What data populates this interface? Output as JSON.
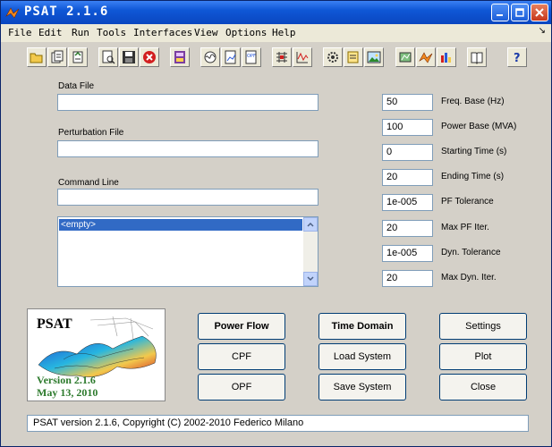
{
  "window": {
    "title": "PSAT 2.1.6"
  },
  "menu": [
    "File",
    "Edit",
    "Run",
    "Tools",
    "Interfaces",
    "View",
    "Options",
    "Help"
  ],
  "toolbar": {
    "icons": [
      "open-icon",
      "open-data-icon",
      "open-perturbation-icon",
      "view-data-icon",
      "save-icon",
      "close-data-icon",
      "library-icon",
      "simulink-icon",
      "report-icon",
      "opf-report-icon",
      "matrix-icon",
      "plot-icon",
      "settings-gear-icon",
      "edit-note-icon",
      "image-icon",
      "setup-icon",
      "matlab-icon",
      "bars-icon",
      "book-icon",
      "help-icon"
    ]
  },
  "left": {
    "data_file": {
      "label": "Data File",
      "value": ""
    },
    "perturbation_file": {
      "label": "Perturbation File",
      "value": ""
    },
    "command_line": {
      "label": "Command Line",
      "value": ""
    },
    "listbox": {
      "items": [
        "<empty>"
      ]
    }
  },
  "right": {
    "params": [
      {
        "value": "50",
        "label": "Freq. Base (Hz)"
      },
      {
        "value": "100",
        "label": "Power Base (MVA)"
      },
      {
        "value": "0",
        "label": "Starting Time (s)"
      },
      {
        "value": "20",
        "label": "Ending Time (s)"
      },
      {
        "value": "1e-005",
        "label": "PF Tolerance"
      },
      {
        "value": "20",
        "label": "Max PF Iter."
      },
      {
        "value": "1e-005",
        "label": "Dyn. Tolerance"
      },
      {
        "value": "20",
        "label": "Max Dyn. Iter."
      }
    ]
  },
  "logo": {
    "title": "PSAT",
    "version": "Version 2.1.6",
    "date": "May 13, 2010"
  },
  "buttons": {
    "power_flow": "Power Flow",
    "time_domain": "Time Domain",
    "settings": "Settings",
    "cpf": "CPF",
    "load_system": "Load System",
    "plot": "Plot",
    "opf": "OPF",
    "save_system": "Save System",
    "close": "Close"
  },
  "status": {
    "text": "PSAT version 2.1.6, Copyright (C) 2002-2010 Federico Milano"
  },
  "colors": {
    "title_bar": "#0f57d6",
    "window_bg": "#d4d0c8",
    "selection": "#316ac5",
    "logo_version": "#2c7a2c"
  }
}
